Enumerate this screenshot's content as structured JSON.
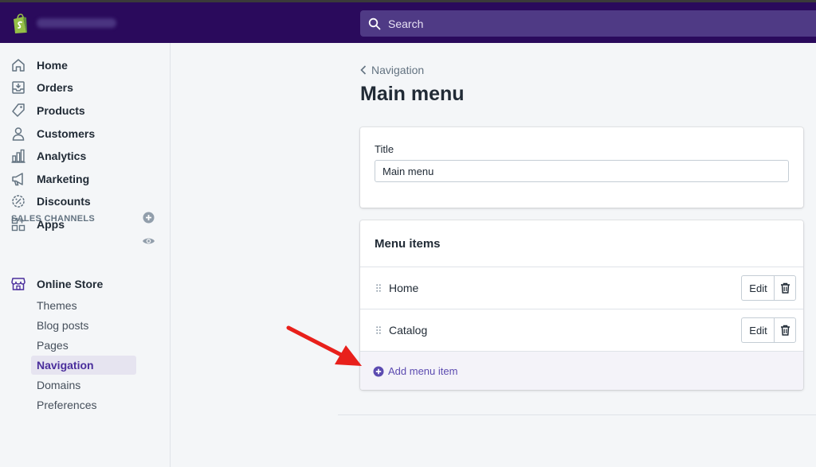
{
  "topbar": {
    "search_placeholder": "Search"
  },
  "sidebar": {
    "items": [
      {
        "label": "Home",
        "icon": "home-icon"
      },
      {
        "label": "Orders",
        "icon": "orders-icon"
      },
      {
        "label": "Products",
        "icon": "tag-icon"
      },
      {
        "label": "Customers",
        "icon": "person-icon"
      },
      {
        "label": "Analytics",
        "icon": "bar-chart-icon"
      },
      {
        "label": "Marketing",
        "icon": "megaphone-icon"
      },
      {
        "label": "Discounts",
        "icon": "discount-icon"
      },
      {
        "label": "Apps",
        "icon": "apps-icon"
      }
    ],
    "sales_channels_header": "SALES CHANNELS",
    "online_store": {
      "label": "Online Store",
      "subitems": [
        "Themes",
        "Blog posts",
        "Pages",
        "Navigation",
        "Domains",
        "Preferences"
      ],
      "active": "Navigation"
    }
  },
  "main": {
    "breadcrumb": "Navigation",
    "page_title": "Main menu",
    "title_card": {
      "label": "Title",
      "value": "Main menu"
    },
    "menu_card": {
      "header": "Menu items",
      "items": [
        {
          "label": "Home",
          "edit_label": "Edit"
        },
        {
          "label": "Catalog",
          "edit_label": "Edit"
        }
      ],
      "add_label": "Add menu item"
    }
  },
  "colors": {
    "topbar": "#2a0a5c",
    "accent": "#5c4bb0",
    "annotation_arrow": "#e8201b"
  }
}
